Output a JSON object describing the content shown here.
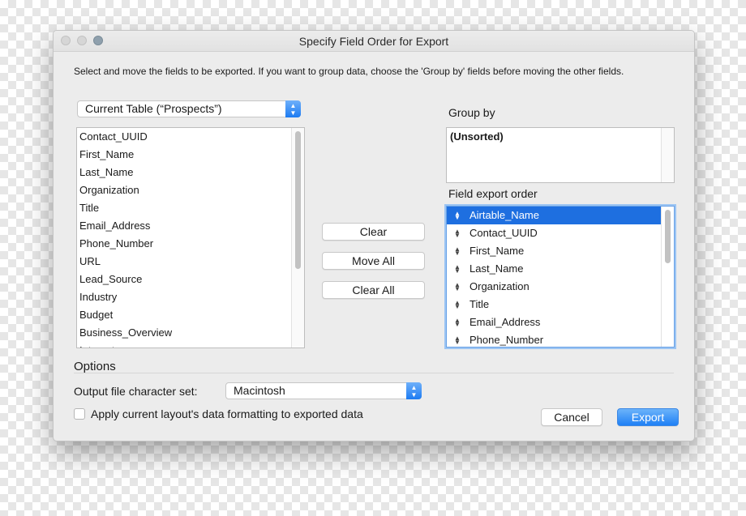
{
  "window": {
    "title": "Specify Field Order for Export"
  },
  "instructions": "Select and move the fields to be exported.  If you want to group data, choose the 'Group by' fields before moving the other fields.",
  "table_selector": {
    "value": "Current Table (“Prospects”)"
  },
  "available_fields": [
    "Contact_UUID",
    "First_Name",
    "Last_Name",
    "Organization",
    "Title",
    "Email_Address",
    "Phone_Number",
    "URL",
    "Lead_Source",
    "Industry",
    "Budget",
    "Business_Overview",
    "Interests"
  ],
  "buttons": {
    "clear": "Clear",
    "move_all": "Move All",
    "clear_all": "Clear All",
    "cancel": "Cancel",
    "export": "Export"
  },
  "group_by": {
    "label": "Group by",
    "items": [
      "(Unsorted)"
    ]
  },
  "export_order": {
    "label": "Field export order",
    "selected_index": 0,
    "items": [
      "Airtable_Name",
      "Contact_UUID",
      "First_Name",
      "Last_Name",
      "Organization",
      "Title",
      "Email_Address",
      "Phone_Number"
    ]
  },
  "options": {
    "label": "Options",
    "charset_label": "Output file character set:",
    "charset_value": "Macintosh",
    "apply_formatting_label": "Apply current layout's data formatting to exported data",
    "apply_formatting_checked": false
  },
  "colors": {
    "accent": "#1e6fe0",
    "window_bg": "#ececec"
  }
}
